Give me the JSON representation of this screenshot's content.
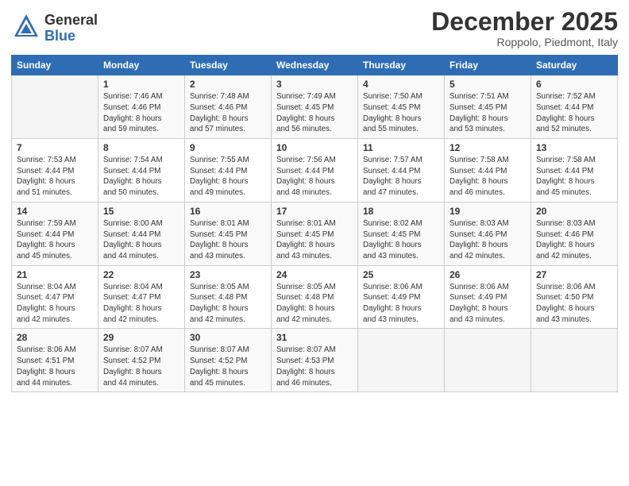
{
  "header": {
    "logo_general": "General",
    "logo_blue": "Blue",
    "month_title": "December 2025",
    "location": "Roppolo, Piedmont, Italy"
  },
  "days_of_week": [
    "Sunday",
    "Monday",
    "Tuesday",
    "Wednesday",
    "Thursday",
    "Friday",
    "Saturday"
  ],
  "weeks": [
    [
      {
        "day": "",
        "info": ""
      },
      {
        "day": "1",
        "info": "Sunrise: 7:46 AM\nSunset: 4:46 PM\nDaylight: 8 hours\nand 59 minutes."
      },
      {
        "day": "2",
        "info": "Sunrise: 7:48 AM\nSunset: 4:46 PM\nDaylight: 8 hours\nand 57 minutes."
      },
      {
        "day": "3",
        "info": "Sunrise: 7:49 AM\nSunset: 4:45 PM\nDaylight: 8 hours\nand 56 minutes."
      },
      {
        "day": "4",
        "info": "Sunrise: 7:50 AM\nSunset: 4:45 PM\nDaylight: 8 hours\nand 55 minutes."
      },
      {
        "day": "5",
        "info": "Sunrise: 7:51 AM\nSunset: 4:45 PM\nDaylight: 8 hours\nand 53 minutes."
      },
      {
        "day": "6",
        "info": "Sunrise: 7:52 AM\nSunset: 4:44 PM\nDaylight: 8 hours\nand 52 minutes."
      }
    ],
    [
      {
        "day": "7",
        "info": "Sunrise: 7:53 AM\nSunset: 4:44 PM\nDaylight: 8 hours\nand 51 minutes."
      },
      {
        "day": "8",
        "info": "Sunrise: 7:54 AM\nSunset: 4:44 PM\nDaylight: 8 hours\nand 50 minutes."
      },
      {
        "day": "9",
        "info": "Sunrise: 7:55 AM\nSunset: 4:44 PM\nDaylight: 8 hours\nand 49 minutes."
      },
      {
        "day": "10",
        "info": "Sunrise: 7:56 AM\nSunset: 4:44 PM\nDaylight: 8 hours\nand 48 minutes."
      },
      {
        "day": "11",
        "info": "Sunrise: 7:57 AM\nSunset: 4:44 PM\nDaylight: 8 hours\nand 47 minutes."
      },
      {
        "day": "12",
        "info": "Sunrise: 7:58 AM\nSunset: 4:44 PM\nDaylight: 8 hours\nand 46 minutes."
      },
      {
        "day": "13",
        "info": "Sunrise: 7:58 AM\nSunset: 4:44 PM\nDaylight: 8 hours\nand 45 minutes."
      }
    ],
    [
      {
        "day": "14",
        "info": "Sunrise: 7:59 AM\nSunset: 4:44 PM\nDaylight: 8 hours\nand 45 minutes."
      },
      {
        "day": "15",
        "info": "Sunrise: 8:00 AM\nSunset: 4:44 PM\nDaylight: 8 hours\nand 44 minutes."
      },
      {
        "day": "16",
        "info": "Sunrise: 8:01 AM\nSunset: 4:45 PM\nDaylight: 8 hours\nand 43 minutes."
      },
      {
        "day": "17",
        "info": "Sunrise: 8:01 AM\nSunset: 4:45 PM\nDaylight: 8 hours\nand 43 minutes."
      },
      {
        "day": "18",
        "info": "Sunrise: 8:02 AM\nSunset: 4:45 PM\nDaylight: 8 hours\nand 43 minutes."
      },
      {
        "day": "19",
        "info": "Sunrise: 8:03 AM\nSunset: 4:46 PM\nDaylight: 8 hours\nand 42 minutes."
      },
      {
        "day": "20",
        "info": "Sunrise: 8:03 AM\nSunset: 4:46 PM\nDaylight: 8 hours\nand 42 minutes."
      }
    ],
    [
      {
        "day": "21",
        "info": "Sunrise: 8:04 AM\nSunset: 4:47 PM\nDaylight: 8 hours\nand 42 minutes."
      },
      {
        "day": "22",
        "info": "Sunrise: 8:04 AM\nSunset: 4:47 PM\nDaylight: 8 hours\nand 42 minutes."
      },
      {
        "day": "23",
        "info": "Sunrise: 8:05 AM\nSunset: 4:48 PM\nDaylight: 8 hours\nand 42 minutes."
      },
      {
        "day": "24",
        "info": "Sunrise: 8:05 AM\nSunset: 4:48 PM\nDaylight: 8 hours\nand 42 minutes."
      },
      {
        "day": "25",
        "info": "Sunrise: 8:06 AM\nSunset: 4:49 PM\nDaylight: 8 hours\nand 43 minutes."
      },
      {
        "day": "26",
        "info": "Sunrise: 8:06 AM\nSunset: 4:49 PM\nDaylight: 8 hours\nand 43 minutes."
      },
      {
        "day": "27",
        "info": "Sunrise: 8:06 AM\nSunset: 4:50 PM\nDaylight: 8 hours\nand 43 minutes."
      }
    ],
    [
      {
        "day": "28",
        "info": "Sunrise: 8:06 AM\nSunset: 4:51 PM\nDaylight: 8 hours\nand 44 minutes."
      },
      {
        "day": "29",
        "info": "Sunrise: 8:07 AM\nSunset: 4:52 PM\nDaylight: 8 hours\nand 44 minutes."
      },
      {
        "day": "30",
        "info": "Sunrise: 8:07 AM\nSunset: 4:52 PM\nDaylight: 8 hours\nand 45 minutes."
      },
      {
        "day": "31",
        "info": "Sunrise: 8:07 AM\nSunset: 4:53 PM\nDaylight: 8 hours\nand 46 minutes."
      },
      {
        "day": "",
        "info": ""
      },
      {
        "day": "",
        "info": ""
      },
      {
        "day": "",
        "info": ""
      }
    ]
  ]
}
